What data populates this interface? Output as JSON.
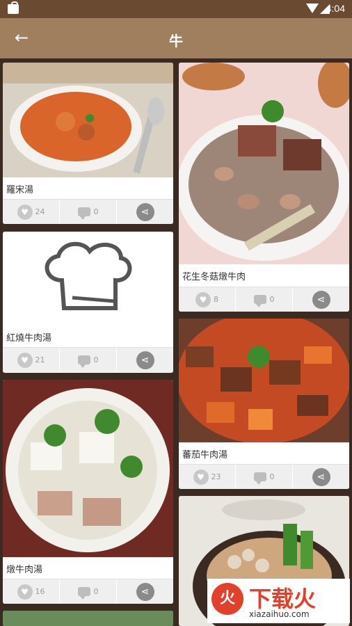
{
  "status": {
    "time": "4:04"
  },
  "appbar": {
    "title": "牛",
    "back_icon": "arrow-left-icon"
  },
  "cards": [
    {
      "name": "羅宋湯",
      "likes": "24",
      "comments": "0"
    },
    {
      "name": "紅燒牛肉湯",
      "likes": "21",
      "comments": "0"
    },
    {
      "name": "燉牛肉湯",
      "likes": "16",
      "comments": "0"
    },
    {
      "name": "花生冬菇燉牛肉",
      "likes": "8",
      "comments": "0"
    },
    {
      "name": "蕃茄牛肉湯",
      "likes": "23",
      "comments": "0"
    }
  ],
  "watermark": {
    "logo_char": "火",
    "brand": "下载火",
    "url": "xiazaihuo.com"
  },
  "colors": {
    "appbar": "#a07f5f",
    "statusbar": "#6b4a32",
    "watermark": "#e1402a"
  }
}
